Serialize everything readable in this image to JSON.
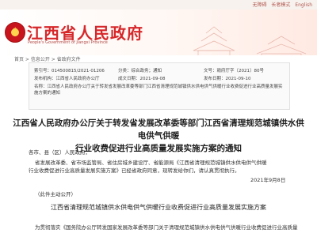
{
  "topbar": {
    "links": [
      "无障碍",
      "长者模式",
      "English"
    ]
  },
  "header": {
    "site_title": "江西省人民政府",
    "site_subtitle": "People's Government of Jiangxi Province"
  },
  "breadcrumb": "首页 > 信息公开 > 省政府文件",
  "meta": {
    "index_label": "索引号：",
    "index_value": "014500815/2021-01206",
    "category_label": "分类：",
    "category_value": "综合政务；通知",
    "issuer_label": "发布机构：",
    "issuer_value": "江西省人民政府办公厅",
    "date_label": "成文日期：",
    "date_value": "2021-09-08",
    "title_label": "名称：",
    "title_value": "江西省人民政府办公厅关于转发省发展改革委等部门江西省清理规范城镇供水供电供气供暖行业收费促进行业高质量发展实施方案的通知",
    "doc_no_label": "文号：",
    "doc_no_value": "赣府厅字〔2021〕80号",
    "pub_date_label": "发布日期：",
    "pub_date_value": "2021-09-10"
  },
  "document": {
    "title_line1": "江西省人民政府办公厅关于转发省发展改革委等部门江西省清理规范城镇供水供电供气供暖",
    "title_line2": "行业收费促进行业高质量发展实施方案的通知",
    "addressee": "各市、县（区）人民政府，",
    "body_line1": "省发展改革委、省市场监管局、省住房城乡建设厅、省能源局《江西省清理规范城镇供水供电供气供暖",
    "body_line2": "行业收费促进行业高质量发展实施方案》已经省政府同意，现转发给你们，请认真贯彻执行。",
    "signature_date": "2021年9月8日",
    "note": "（此件主动公开）",
    "sub_title": "江西省清理规范城镇供水供电供气供暖行业收费促进行业高质量发展实施方案",
    "body_line3": "为贯彻落实《国务院办公厅转发国家发展改革委等部门关于清理规范城镇供水供电供气供暖行业收费促进行业高质量"
  },
  "colors": {
    "brand_red": "#d6282b",
    "banner_tint": "#ffe9e2"
  }
}
